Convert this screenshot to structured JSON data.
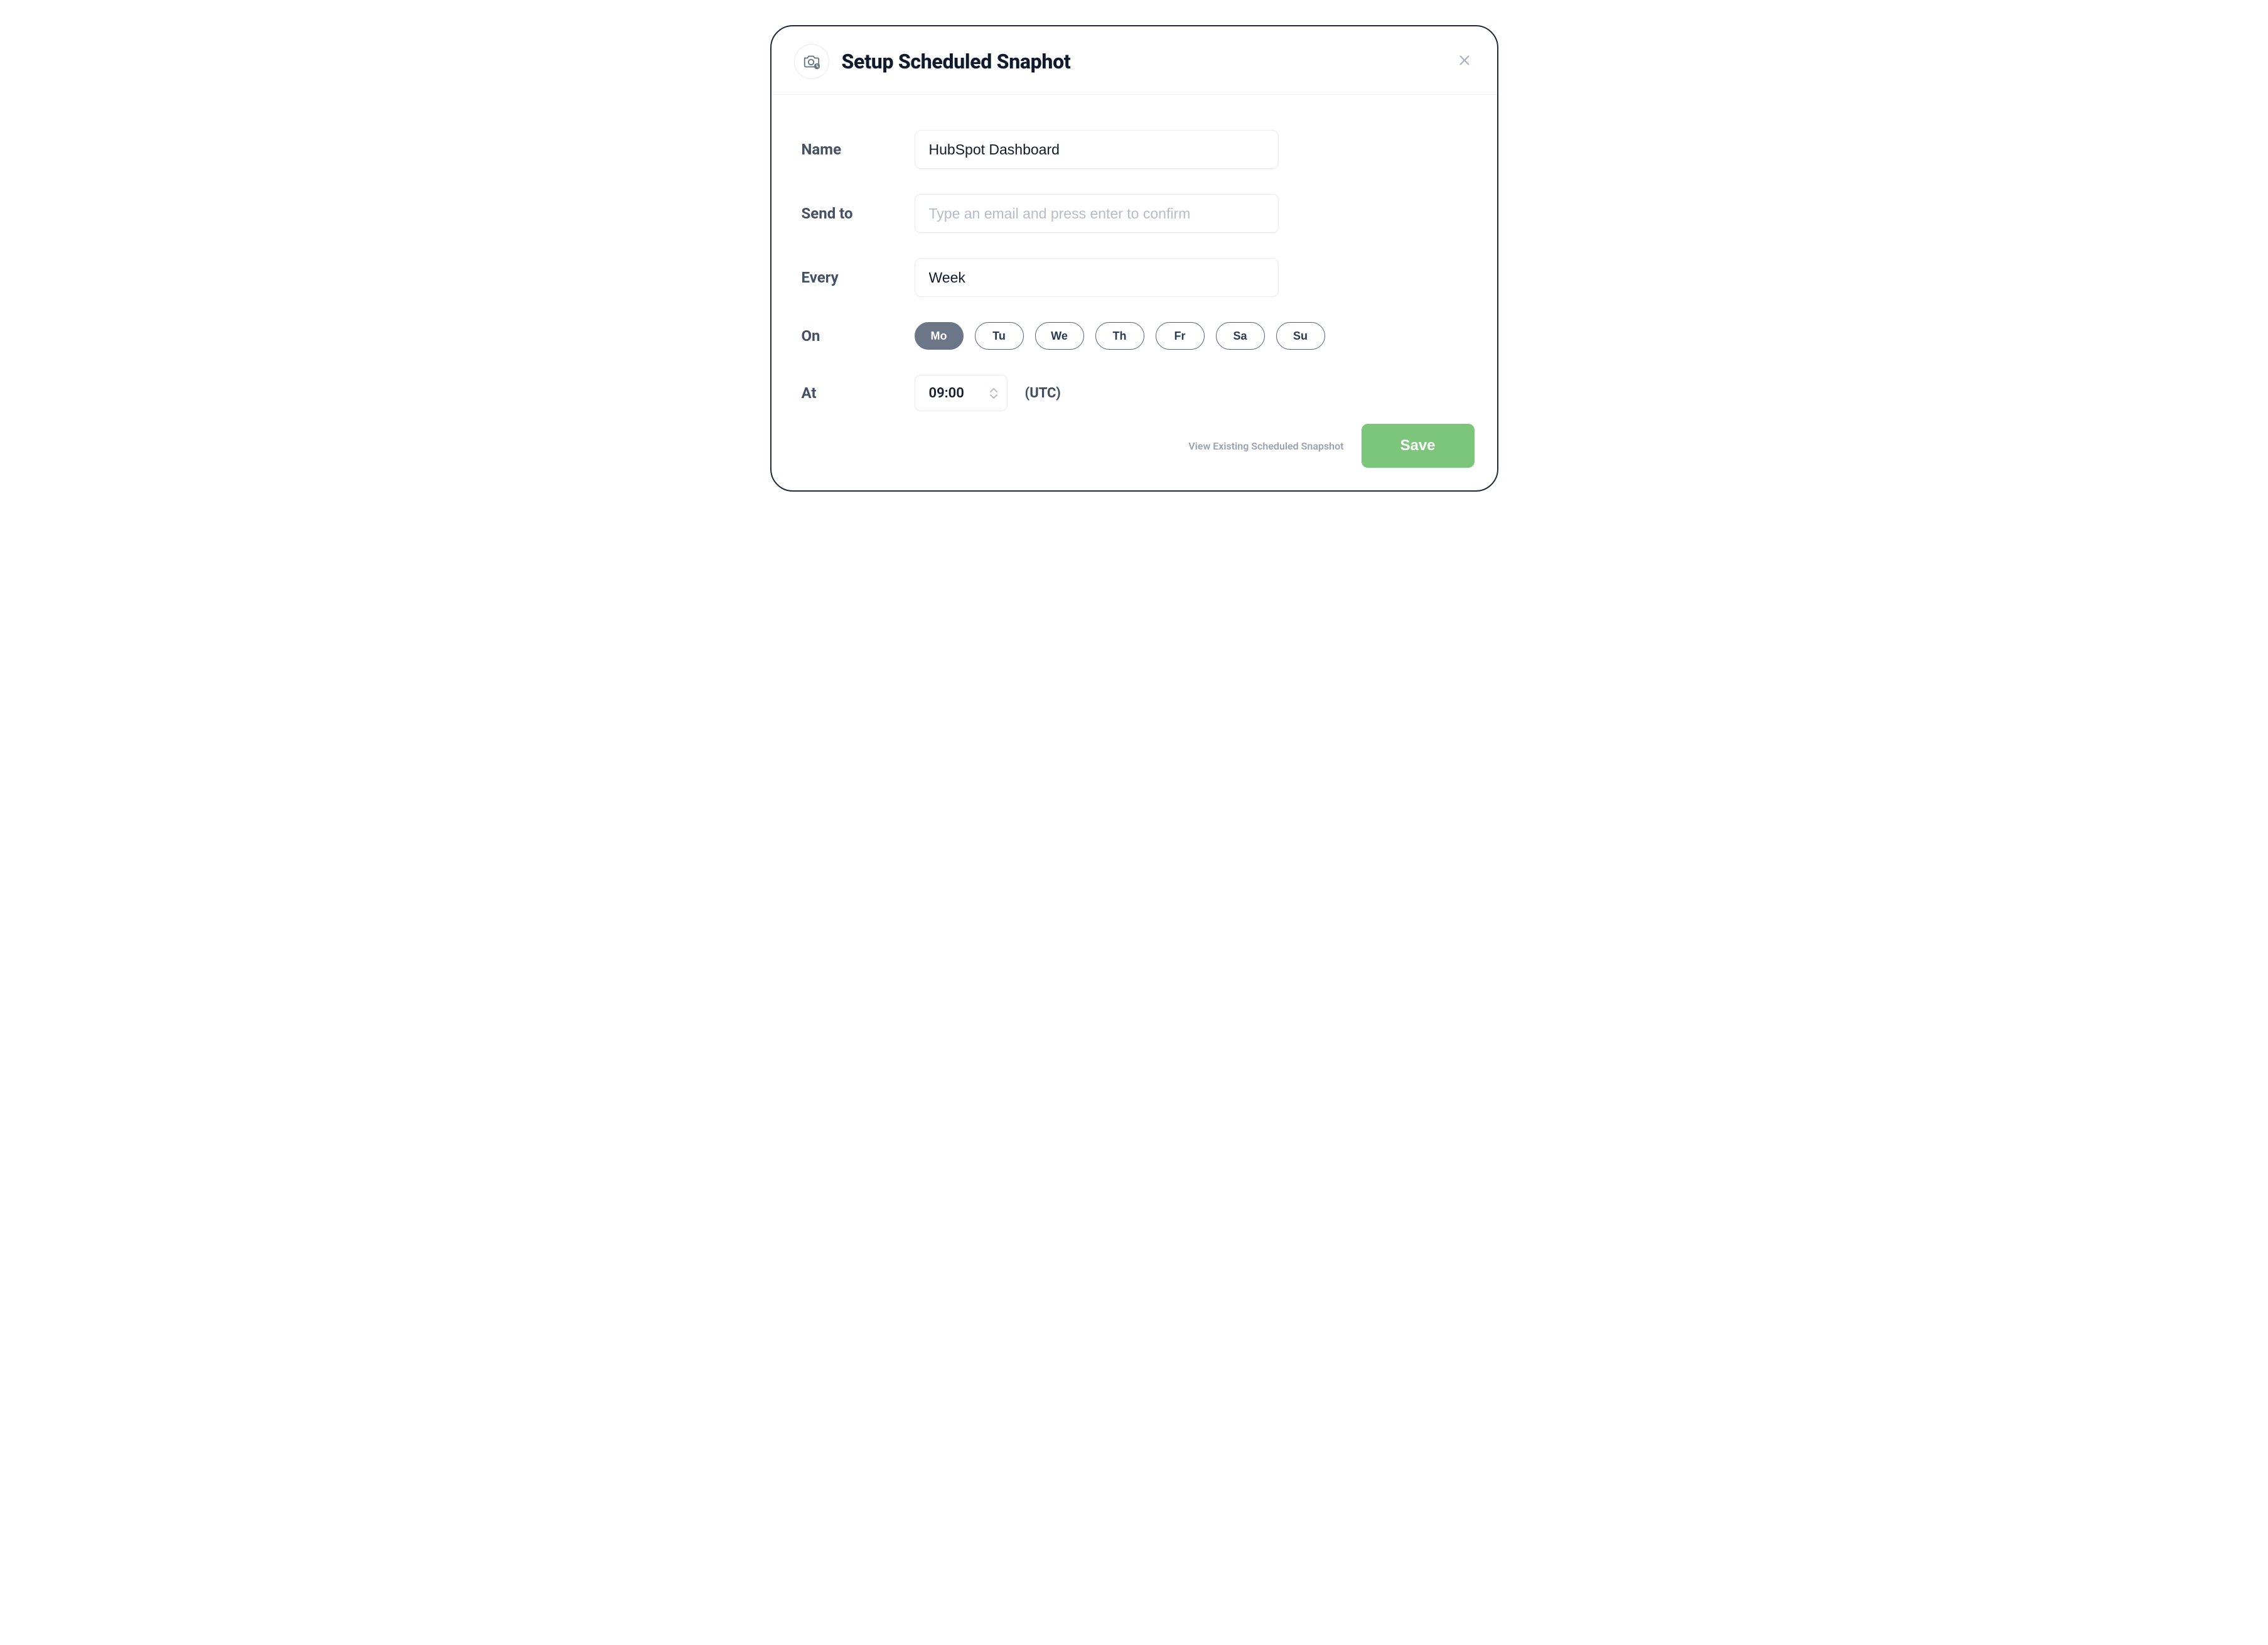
{
  "modal": {
    "title": "Setup Scheduled Snaphot"
  },
  "form": {
    "name": {
      "label": "Name",
      "value": "HubSpot Dashboard"
    },
    "send_to": {
      "label": "Send to",
      "placeholder": "Type an email and press enter to confirm",
      "value": ""
    },
    "every": {
      "label": "Every",
      "value": "Week"
    },
    "on": {
      "label": "On",
      "days": [
        {
          "label": "Mo",
          "active": true
        },
        {
          "label": "Tu",
          "active": false
        },
        {
          "label": "We",
          "active": false
        },
        {
          "label": "Th",
          "active": false
        },
        {
          "label": "Fr",
          "active": false
        },
        {
          "label": "Sa",
          "active": false
        },
        {
          "label": "Su",
          "active": false
        }
      ]
    },
    "at": {
      "label": "At",
      "time": "09:00",
      "tz": "(UTC)"
    }
  },
  "footer": {
    "view_link": "View Existing Scheduled Snapshot",
    "save_label": "Save"
  }
}
